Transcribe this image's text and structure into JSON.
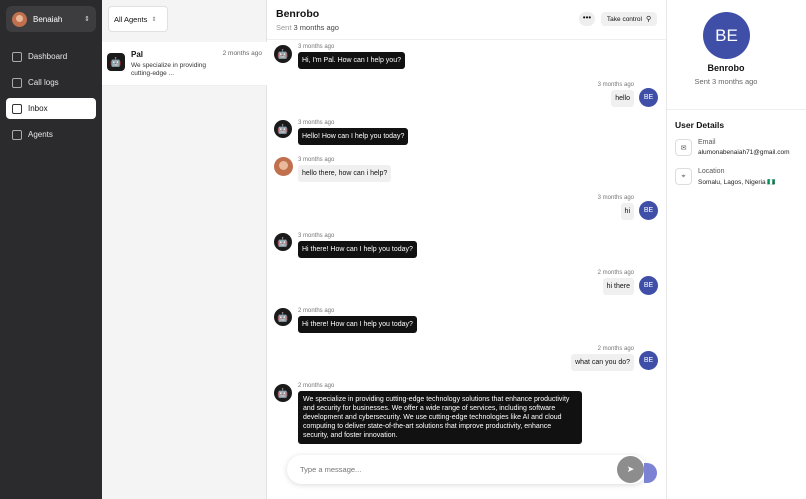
{
  "sidebar": {
    "user_name": "Benaiah",
    "items": [
      {
        "label": "Dashboard",
        "icon": "grid-icon"
      },
      {
        "label": "Call logs",
        "icon": "phone-icon"
      },
      {
        "label": "Inbox",
        "icon": "inbox-icon"
      },
      {
        "label": "Agents",
        "icon": "bot-icon"
      }
    ]
  },
  "conversations": {
    "filter_label": "All Agents",
    "items": [
      {
        "name": "Pal",
        "time": "2 months ago",
        "preview": "We specialize in providing cutting-edge ..."
      }
    ]
  },
  "chat": {
    "title": "Benrobo",
    "sent_label": "Sent",
    "sent_time": "3 months ago",
    "more_label": "•••",
    "take_control_label": "Take control",
    "messages": [
      {
        "side": "left",
        "kind": "bot",
        "time": "3 months ago",
        "text": "Hi, I'm Pal. How can I help you?"
      },
      {
        "side": "right",
        "kind": "user",
        "time": "3 months ago",
        "text": "hello",
        "avatar": "BE"
      },
      {
        "side": "left",
        "kind": "bot",
        "time": "3 months ago",
        "text": "Hello! How can I help you today?"
      },
      {
        "side": "left",
        "kind": "human",
        "time": "3 months ago",
        "text": "hello there, how can i help?"
      },
      {
        "side": "right",
        "kind": "user",
        "time": "3 months ago",
        "text": "hi",
        "avatar": "BE"
      },
      {
        "side": "left",
        "kind": "bot",
        "time": "3 months ago",
        "text": "Hi there! How can I help you today?"
      },
      {
        "side": "right",
        "kind": "user",
        "time": "2 months ago",
        "text": "hi there",
        "avatar": "BE"
      },
      {
        "side": "left",
        "kind": "bot",
        "time": "2 months ago",
        "text": "Hi there! How can I help you today?"
      },
      {
        "side": "right",
        "kind": "user",
        "time": "2 months ago",
        "text": "what can you do?",
        "avatar": "BE"
      },
      {
        "side": "left",
        "kind": "bot",
        "time": "2 months ago",
        "text": "We specialize in providing cutting-edge technology solutions that enhance productivity and security for businesses. We offer a wide range of services, including software development and cybersecurity. We use cutting-edge technologies like AI and cloud computing to deliver state-of-the-art solutions that improve productivity, enhance security, and foster innovation."
      }
    ],
    "composer_placeholder": "Type a message..."
  },
  "details": {
    "avatar": "BE",
    "name": "Benrobo",
    "sent": "Sent 3 months ago",
    "section_title": "User Details",
    "email_label": "Email",
    "email_value": "alumonabenaiah71@gmail.com",
    "location_label": "Location",
    "location_value": "Somalu, Lagos, Nigeria 🇳🇬"
  },
  "colors": {
    "sidebar_bg": "#2b2b2d",
    "avatar_blue": "#3f4fa8",
    "bubble_dark": "#111111"
  }
}
